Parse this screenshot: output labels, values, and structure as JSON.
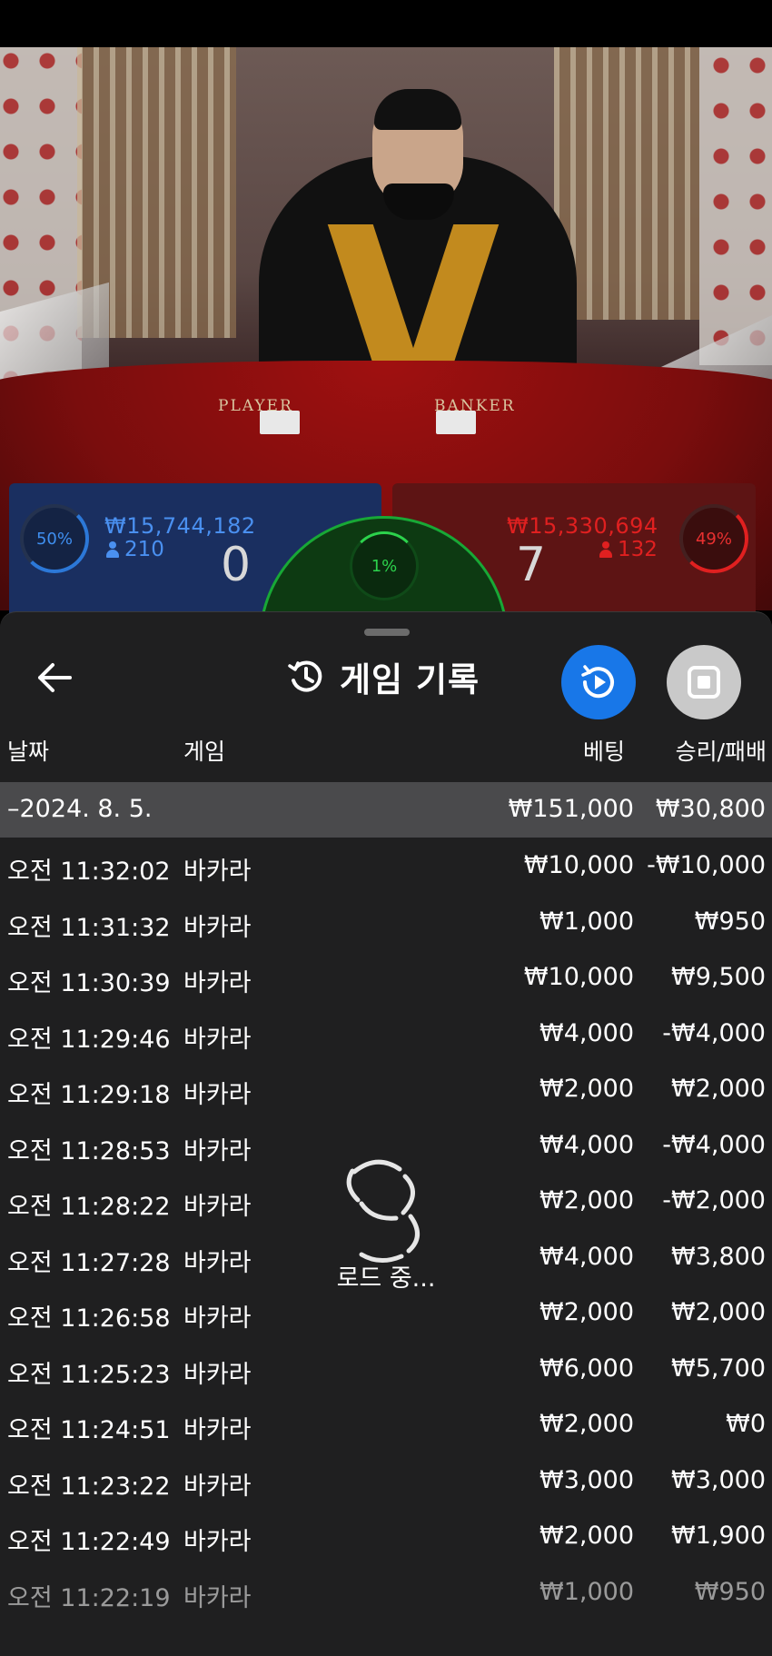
{
  "video": {
    "table_labels": [
      "PLAYER",
      "BANKER"
    ]
  },
  "scoreboard": {
    "player": {
      "percent": "50%",
      "amount": "₩15,744,182",
      "bettors": "210",
      "score": "0"
    },
    "banker": {
      "percent": "49%",
      "amount": "₩15,330,694",
      "bettors": "132",
      "score": "7"
    },
    "tie": {
      "percent": "1%"
    }
  },
  "history": {
    "title": "게임 기록",
    "columns": {
      "date": "날짜",
      "game": "게임",
      "bet": "베팅",
      "win_loss": "승리/패배"
    },
    "summary": {
      "date": "–2024. 8. 5.",
      "bet": "₩151,000",
      "win_loss": "₩30,800"
    },
    "rows": [
      {
        "time": "오전 11:32:02",
        "game": "바카라",
        "bet": "₩10,000",
        "win_loss": "-₩10,000"
      },
      {
        "time": "오전 11:31:32",
        "game": "바카라",
        "bet": "₩1,000",
        "win_loss": "₩950"
      },
      {
        "time": "오전 11:30:39",
        "game": "바카라",
        "bet": "₩10,000",
        "win_loss": "₩9,500"
      },
      {
        "time": "오전 11:29:46",
        "game": "바카라",
        "bet": "₩4,000",
        "win_loss": "-₩4,000"
      },
      {
        "time": "오전 11:29:18",
        "game": "바카라",
        "bet": "₩2,000",
        "win_loss": "₩2,000"
      },
      {
        "time": "오전 11:28:53",
        "game": "바카라",
        "bet": "₩4,000",
        "win_loss": "-₩4,000"
      },
      {
        "time": "오전 11:28:22",
        "game": "바카라",
        "bet": "₩2,000",
        "win_loss": "-₩2,000"
      },
      {
        "time": "오전 11:27:28",
        "game": "바카라",
        "bet": "₩4,000",
        "win_loss": "₩3,800"
      },
      {
        "time": "오전 11:26:58",
        "game": "바카라",
        "bet": "₩2,000",
        "win_loss": "₩2,000"
      },
      {
        "time": "오전 11:25:23",
        "game": "바카라",
        "bet": "₩6,000",
        "win_loss": "₩5,700"
      },
      {
        "time": "오전 11:24:51",
        "game": "바카라",
        "bet": "₩2,000",
        "win_loss": "₩0"
      },
      {
        "time": "오전 11:23:22",
        "game": "바카라",
        "bet": "₩3,000",
        "win_loss": "₩3,000"
      },
      {
        "time": "오전 11:22:49",
        "game": "바카라",
        "bet": "₩2,000",
        "win_loss": "₩1,900"
      },
      {
        "time": "오전 11:22:19",
        "game": "바카라",
        "bet": "₩1,000",
        "win_loss": "₩950"
      }
    ],
    "loading_text": "로드 중..."
  },
  "icons": {
    "back": "arrow-left-icon",
    "history": "history-clock-icon",
    "replay": "replay-play-icon",
    "stop": "stop-square-icon",
    "loader": "loading-spinner-icon",
    "person": "person-icon"
  },
  "colors": {
    "player_blue": "#2c78d8",
    "banker_red": "#e02020",
    "tie_green": "#2cd24c",
    "replay_button": "#1877e8",
    "sheet_bg": "#1f1f20",
    "summary_row": "#4a4a4c"
  }
}
